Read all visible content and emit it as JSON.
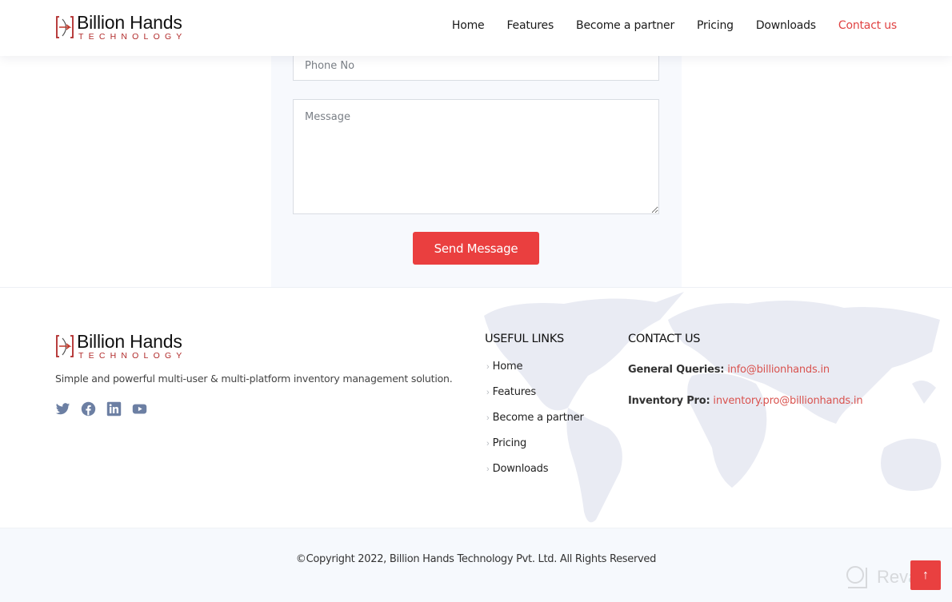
{
  "brand": {
    "name": "Billion Hands",
    "subtitle": "TECHNOLOGY",
    "accent_color": "#e94040",
    "logo_red": "#b12a2a"
  },
  "nav": {
    "items": [
      {
        "label": "Home",
        "active": false
      },
      {
        "label": "Features",
        "active": false
      },
      {
        "label": "Become a partner",
        "active": false
      },
      {
        "label": "Pricing",
        "active": false
      },
      {
        "label": "Downloads",
        "active": false
      },
      {
        "label": "Contact us",
        "active": true
      }
    ]
  },
  "form": {
    "phone_placeholder": "Phone No",
    "phone_value": "",
    "message_placeholder": "Message",
    "message_value": "",
    "send_label": "Send Message"
  },
  "footer": {
    "tagline": "Simple and powerful multi-user & multi-platform inventory management solution.",
    "socials": [
      "twitter-icon",
      "facebook-icon",
      "linkedin-icon",
      "youtube-icon"
    ],
    "useful_links_title": "USEFUL LINKS",
    "useful_links": [
      "Home",
      "Features",
      "Become a partner",
      "Pricing",
      "Downloads"
    ],
    "contact_title": "CONTACT US",
    "contacts": [
      {
        "label": "General Queries:",
        "email": "info@billionhands.in"
      },
      {
        "label": "Inventory Pro:",
        "email": "inventory.pro@billionhands.in"
      }
    ]
  },
  "copyright": "©Copyright 2022, Billion Hands Technology Pvt. Ltd. All Rights Reserved",
  "back_to_top_icon": "arrow-up-icon",
  "watermark": "Revain"
}
